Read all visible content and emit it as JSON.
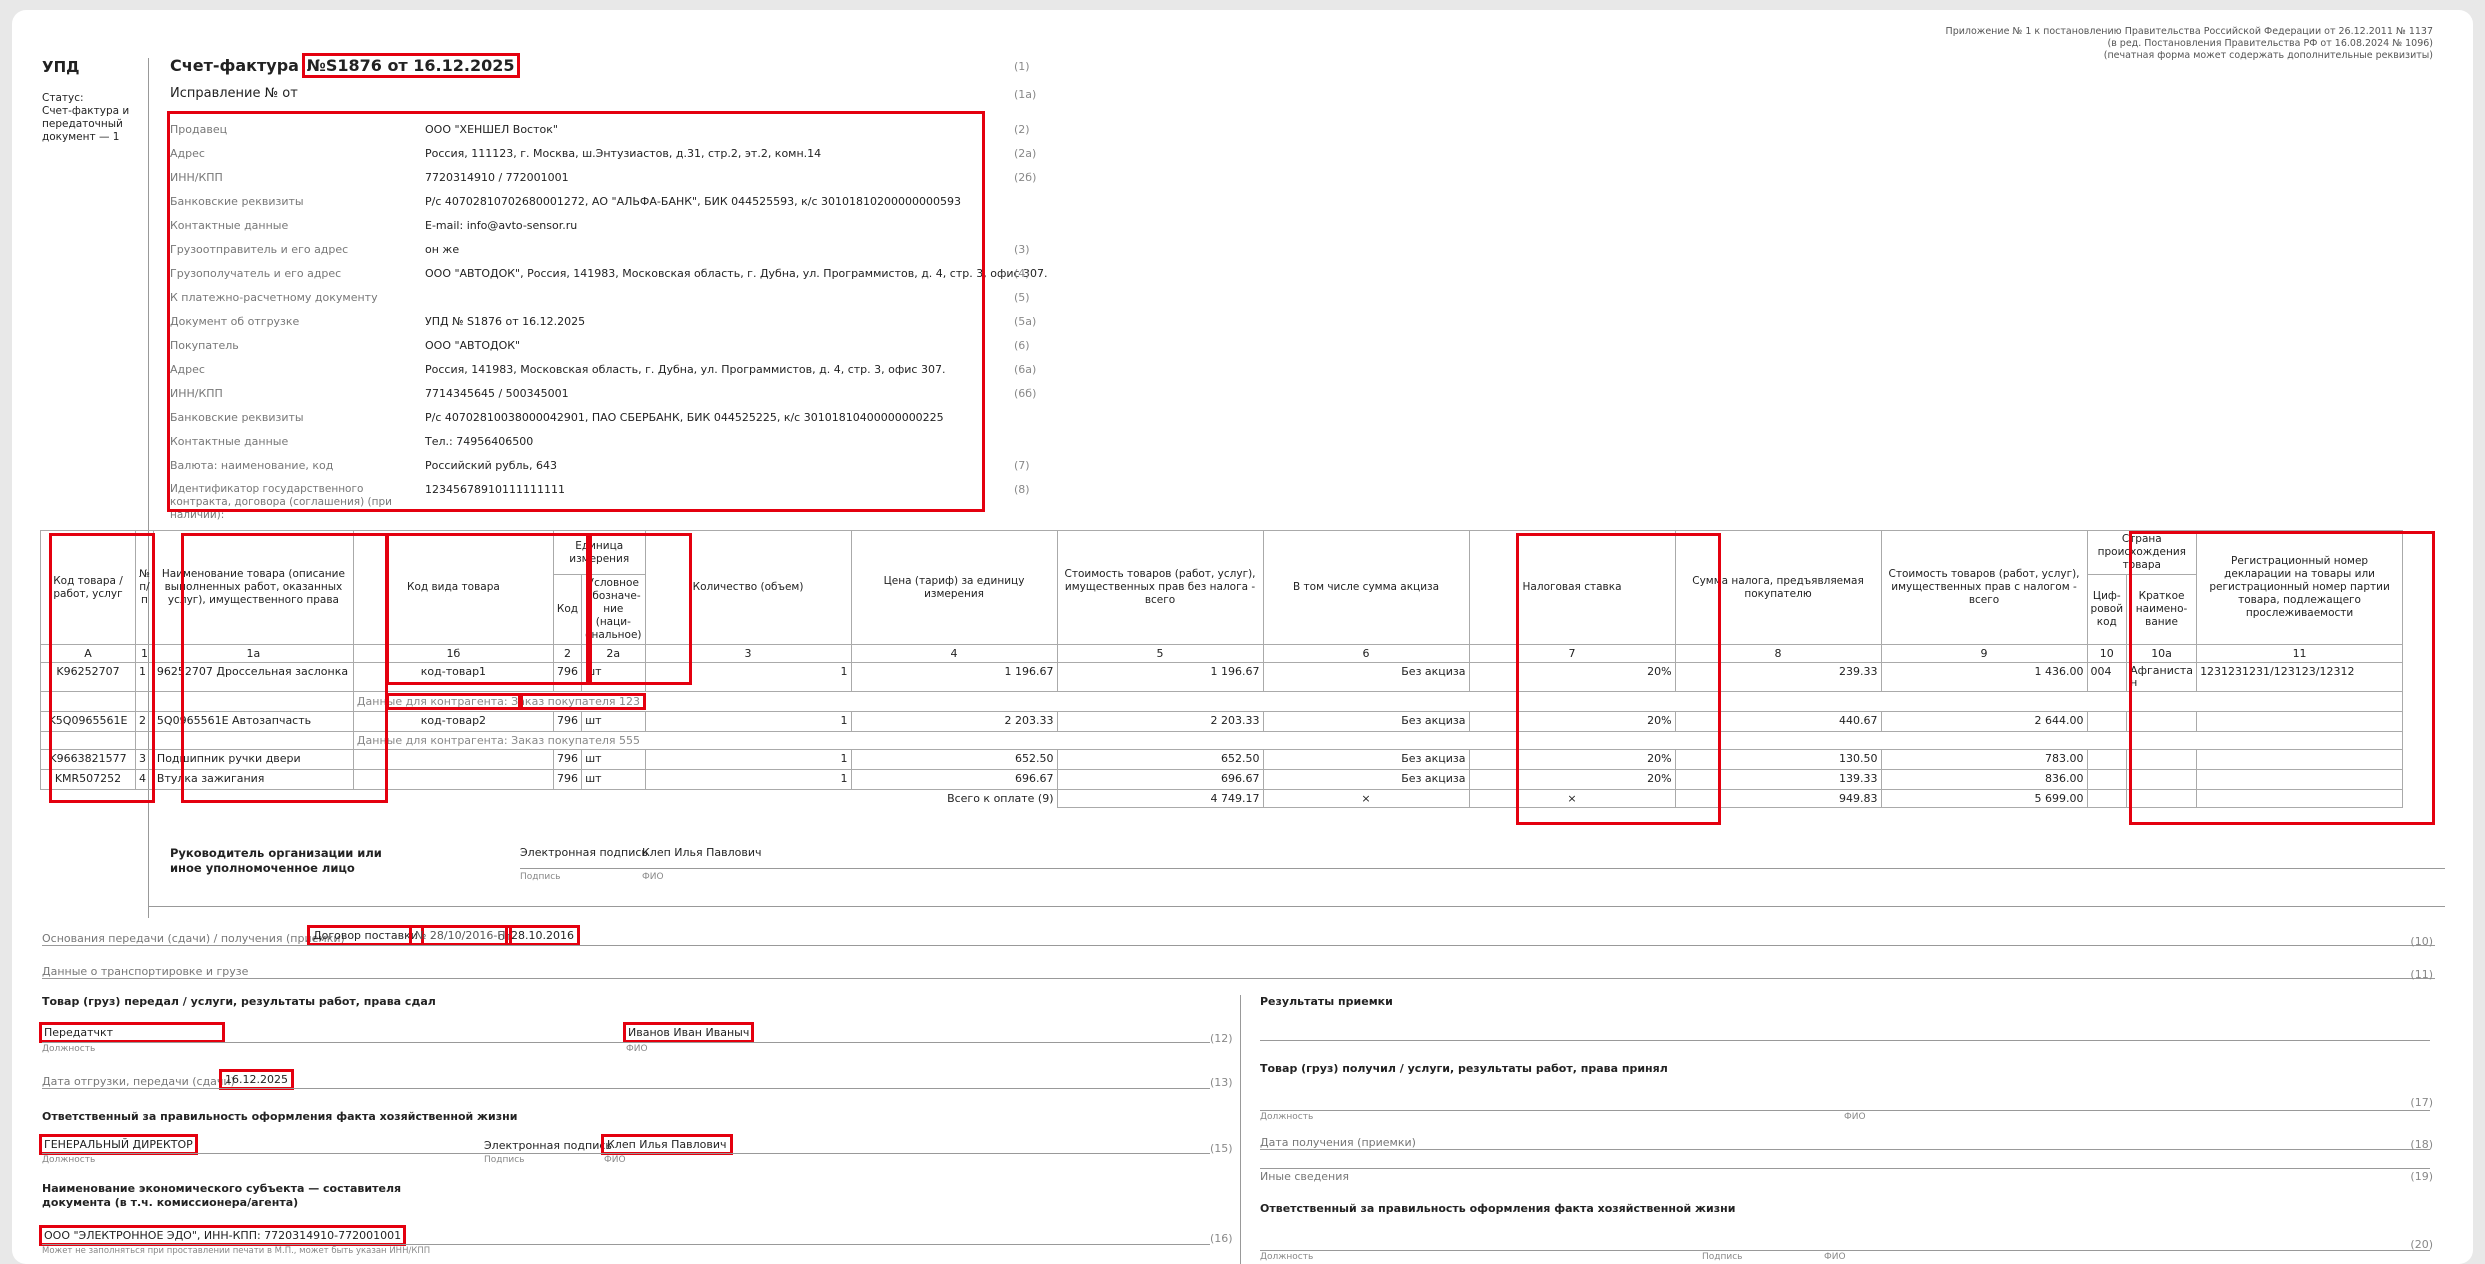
{
  "legal_note": [
    "Приложение № 1 к постановлению Правительства Российской Федерации от 26.12.2011 № 1137",
    "(в ред. Постановления Правительства РФ от 16.08.2024 № 1096)",
    "(печатная форма может содержать дополнительные реквизиты)"
  ],
  "upd": {
    "title": "УПД",
    "status_label": "Статус:",
    "status_text": "Счет-фактура и передаточный документ — 1"
  },
  "invoice": {
    "title_prefix": "Счет-фактура",
    "title_number": "№S1876 от 16.12.2025",
    "title_num_code": "(1)",
    "correction": "Исправление № от",
    "correction_code": "(1а)"
  },
  "details": [
    {
      "label": "Продавец",
      "value": "ООО \"ХЕНШЕЛ Восток\"",
      "code": "(2)"
    },
    {
      "label": "Адрес",
      "value": "Россия, 111123, г. Москва, ш.Энтузиастов, д.31, стр.2, эт.2, комн.14",
      "code": "(2а)"
    },
    {
      "label": "ИНН/КПП",
      "value": "7720314910 / 772001001",
      "code": "(2б)"
    },
    {
      "label": "Банковские реквизиты",
      "value": "Р/с 40702810702680001272, АО \"АЛЬФА-БАНК\", БИК 044525593, к/с 30101810200000000593",
      "code": ""
    },
    {
      "label": "Контактные данные",
      "value": "E-mail: info@avto-sensor.ru",
      "code": ""
    },
    {
      "label": "Грузоотправитель и его адрес",
      "value": "он же",
      "code": "(3)"
    },
    {
      "label": "Грузополучатель и его адрес",
      "value": "ООО \"АВТОДОК\", Россия, 141983, Московская область, г. Дубна, ул. Программистов, д. 4, стр. 3, офис 307.",
      "code": "(4)"
    },
    {
      "label": "К платежно-расчетному документу",
      "value": "",
      "code": "(5)"
    },
    {
      "label": "Документ об отгрузке",
      "value": "УПД № S1876 от 16.12.2025",
      "code": "(5а)"
    },
    {
      "label": "Покупатель",
      "value": "ООО \"АВТОДОК\"",
      "code": "(6)"
    },
    {
      "label": "Адрес",
      "value": "Россия, 141983, Московская область, г. Дубна, ул. Программистов, д. 4, стр. 3, офис 307.",
      "code": "(6а)"
    },
    {
      "label": "ИНН/КПП",
      "value": "7714345645 / 500345001",
      "code": "(6б)"
    },
    {
      "label": "Банковские реквизиты",
      "value": "Р/с 40702810038000042901, ПАО СБЕРБАНК, БИК 044525225, к/с 30101810400000000225",
      "code": ""
    },
    {
      "label": "Контактные данные",
      "value": "Тел.: 74956406500",
      "code": ""
    },
    {
      "label": "Валюта: наименование, код",
      "value": "Российский рубль, 643",
      "code": "(7)"
    },
    {
      "label": "Идентификатор государственного контракта, договора (соглашения) (при наличии):",
      "value": "12345678910111111111",
      "code": "(8)"
    }
  ],
  "table_headers": {
    "code": "Код товара / работ, услуг",
    "num": "№ п/п",
    "name": "Наименование товара (описание выполненных работ, оказанных услуг), имущественного права",
    "kind": "Код вида товара",
    "unit": "Единица измерения",
    "unit_code": "Код",
    "unit_name": "Условное обозначе-ние (наци-ональное)",
    "qty": "Количество (объем)",
    "price": "Цена (тариф) за единицу измерения",
    "cost": "Стоимость товаров (работ, услуг), имущественных прав без налога - всего",
    "excise": "В том числе сумма акциза",
    "rate": "Налоговая ставка",
    "tax": "Сумма налога, предъявляемая покупателю",
    "total": "Стоимость товаров (работ, услуг), имущественных прав с налогом - всего",
    "country": "Страна происхождения товара",
    "country_code": "Циф-ровой код",
    "country_name": "Краткое наимено-вание",
    "reg": "Регистрационный номер декларации на товары или регистрационный номер партии товара, подлежащего прослеживаемости"
  },
  "col_numbers": [
    "А",
    "1",
    "1а",
    "1б",
    "2",
    "2а",
    "3",
    "4",
    "5",
    "6",
    "7",
    "8",
    "9",
    "10",
    "10а",
    "11"
  ],
  "rows": [
    {
      "code": "K96252707",
      "n": "1",
      "name": "96252707 Дроссельная заслонка",
      "kind": "код-товар1",
      "ucode": "796",
      "uname": "шт",
      "qty": "1",
      "price": "1 196.67",
      "cost": "1 196.67",
      "excise": "Без акциза",
      "rate": "20%",
      "tax": "239.33",
      "total": "1 436.00",
      "ccode": "004",
      "cname": "Афганиста н",
      "reg": "1231231231/123123/12312",
      "sub1": "Данные для контрагента:",
      "sub2": "Заказ покупателя 123"
    },
    {
      "code": "K5Q0965561E",
      "n": "2",
      "name": "5Q0965561E Автозапчасть",
      "kind": "код-товар2",
      "ucode": "796",
      "uname": "шт",
      "qty": "1",
      "price": "2 203.33",
      "cost": "2 203.33",
      "excise": "Без акциза",
      "rate": "20%",
      "tax": "440.67",
      "total": "2 644.00",
      "ccode": "",
      "cname": "",
      "reg": "",
      "sub1": "Данные для контрагента:",
      "sub2": "Заказ покупателя 555"
    },
    {
      "code": "K9663821577",
      "n": "3",
      "name": "Подшипник ручки двери",
      "kind": "",
      "ucode": "796",
      "uname": "шт",
      "qty": "1",
      "price": "652.50",
      "cost": "652.50",
      "excise": "Без акциза",
      "rate": "20%",
      "tax": "130.50",
      "total": "783.00",
      "ccode": "",
      "cname": "",
      "reg": "",
      "sub1": "",
      "sub2": ""
    },
    {
      "code": "KMR507252",
      "n": "4",
      "name": "Втулка зажигания",
      "kind": "",
      "ucode": "796",
      "uname": "шт",
      "qty": "1",
      "price": "696.67",
      "cost": "696.67",
      "excise": "Без акциза",
      "rate": "20%",
      "tax": "139.33",
      "total": "836.00",
      "ccode": "",
      "cname": "",
      "reg": "",
      "sub1": "",
      "sub2": ""
    }
  ],
  "totals": {
    "label": "Всего к оплате (9)",
    "cost": "4 749.17",
    "excise": "×",
    "rate": "×",
    "tax": "949.83",
    "total": "5 699.00"
  },
  "head_sign": {
    "title": "Руководитель организации или иное уполномоченное лицо",
    "esign": "Электронная подпись",
    "name": "Клеп Илья Павлович",
    "cap_sign": "Подпись",
    "cap_fio": "ФИО"
  },
  "basis": {
    "label": "Основания передачи (сдачи) / получения (приемки)",
    "doc": "Договор поставки",
    "num": "№ 28/10/2016-П",
    "date_prefix": "от",
    "date": "28.10.2016",
    "code": "(10)"
  },
  "transport": {
    "label": "Данные о транспортировке и грузе",
    "code": "(11)"
  },
  "left": {
    "transfer_title": "Товар (груз) передал / услуги, результаты работ, права сдал",
    "position": "Передатчкт",
    "fio": "Иванов Иван Иваныч",
    "cap_position": "Должность",
    "cap_fio": "ФИО",
    "code12": "(12)",
    "ship_label": "Дата отгрузки, передачи (сдачи)",
    "ship_date": "16.12.2025",
    "code13": "(13)",
    "resp_title": "Ответственный за правильность оформления факта хозяйственной жизни",
    "resp_position": "ГЕНЕРАЛЬНЫЙ ДИРЕКТОР",
    "resp_esign": "Электронная подпись",
    "resp_fio": "Клеп Илья Павлович",
    "cap_sign": "Подпись",
    "code15": "(15)",
    "subject_title": "Наименование экономического субъекта — составителя документа (в т.ч. комиссионера/агента)",
    "subject": "ООО \"ЭЛЕКТРОННОЕ ЭДО\", ИНН-КПП: 7720314910-772001001",
    "code16": "(16)",
    "subject_note": "Может не заполняться при проставлении печати в М.П., может быть указан ИНН/КПП"
  },
  "right": {
    "results_title": "Результаты приемки",
    "received_title": "Товар (груз) получил / услуги, результаты работ, права принял",
    "code17": "(17)",
    "cap_position": "Должность",
    "cap_fio": "ФИО",
    "receive_date": "Дата получения (приемки)",
    "code18": "(18)",
    "other": "Иные сведения",
    "code19": "(19)",
    "resp_title": "Ответственный за правильность оформления факта хозяйственной жизни",
    "code20": "(20)",
    "cap_sign": "Подпись"
  }
}
